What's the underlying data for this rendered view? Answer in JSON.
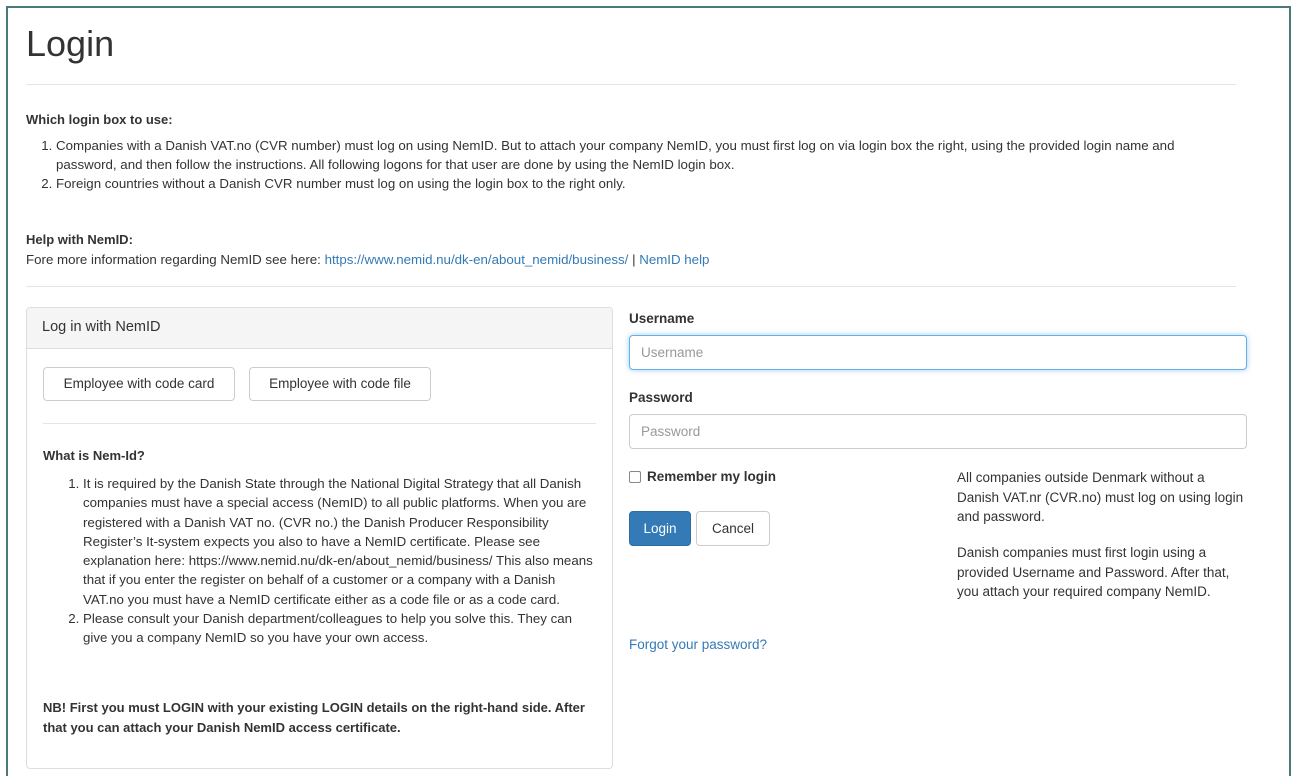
{
  "page": {
    "title": "Login"
  },
  "intro": {
    "heading": "Which login box to use:",
    "items": [
      "Companies with a Danish VAT.no (CVR number) must log on using NemID. But to attach your company NemID, you must first log on via login box the right, using the provided login name and password, and then follow the instructions. All following logons for that user are done by using the NemID login box.",
      "Foreign countries without a Danish CVR number must log on using the login box to the right only."
    ]
  },
  "help": {
    "heading": "Help with NemID:",
    "prefix": "Fore more information regarding NemID see here: ",
    "link_url_text": "https://www.nemid.nu/dk-en/about_nemid/business/",
    "separator": " | ",
    "help_link": "NemID help"
  },
  "nemid_panel": {
    "heading": "Log in with NemID",
    "btn_code_card": "Employee with code card",
    "btn_code_file": "Employee with code file",
    "whatis_heading": "What is Nem-Id?",
    "whatis_items": [
      "It is required by the Danish State through the National Digital Strategy that all Danish companies must have a special access (NemID) to all public platforms. When you are registered with a Danish VAT no. (CVR no.) the Danish Producer Responsibility Register’s It-system expects you also to have a NemID certificate. Please see explanation here: https://www.nemid.nu/dk-en/about_nemid/business/ This also means that if you enter the register on behalf of a customer or a company with a Danish VAT.no you must have a NemID certificate either as a code file or as a code card.",
      "Please consult your Danish department/colleagues to help you solve this. They can give you a company NemID so you have your own access."
    ],
    "nb_text": "NB! First you must LOGIN with your existing LOGIN details on the right-hand side. After that you can attach your Danish NemID access certificate."
  },
  "login_form": {
    "username_label": "Username",
    "username_placeholder": "Username",
    "password_label": "Password",
    "password_placeholder": "Password",
    "remember_label": "Remember my login",
    "login_button": "Login",
    "cancel_button": "Cancel",
    "forgot_link": "Forgot your password?",
    "side_text_1": "All companies outside Denmark without a Danish VAT.nr (CVR.no) must log on using login and password.",
    "side_text_2": "Danish companies must first login using a provided Username and Password. After that, you attach your required company NemID."
  },
  "colors": {
    "link": "#337ab7",
    "primary_button": "#337ab7",
    "frame_border": "#4a7a78"
  }
}
